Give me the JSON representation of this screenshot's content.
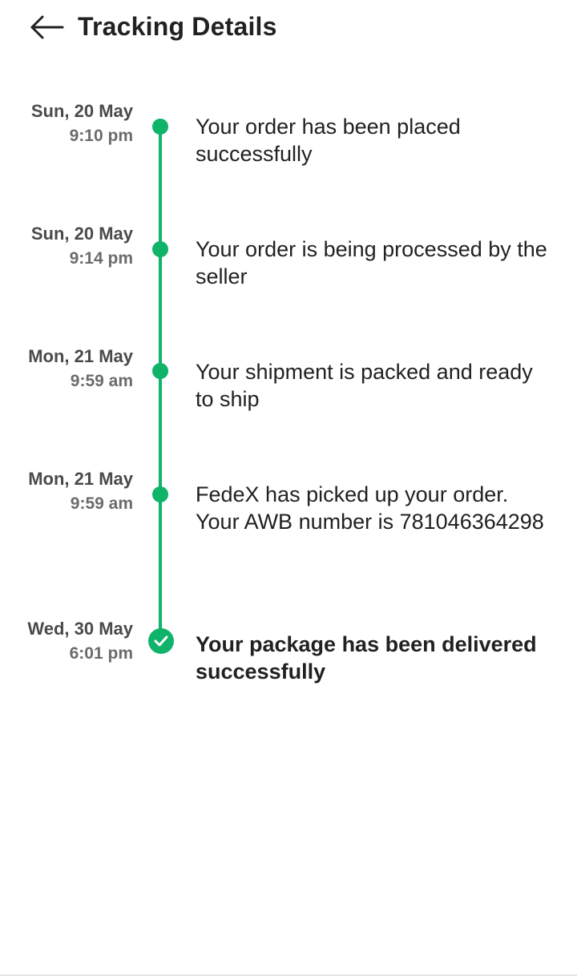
{
  "header": {
    "title": "Tracking Details",
    "back_icon": "arrow-left-icon"
  },
  "colors": {
    "accent": "#0fb36a",
    "text_primary": "#212121",
    "text_date": "#4a4a4a",
    "text_time": "#6b6b6b"
  },
  "events": [
    {
      "date": "Sun, 20 May",
      "time": "9:10 pm",
      "description": "Your order has been placed successfully",
      "completed": false
    },
    {
      "date": "Sun, 20 May",
      "time": "9:14 pm",
      "description": "Your order is being processed by the seller",
      "completed": false
    },
    {
      "date": "Mon, 21 May",
      "time": "9:59 am",
      "description": "Your shipment is packed and ready to ship",
      "completed": false
    },
    {
      "date": "Mon, 21 May",
      "time": "9:59 am",
      "description": "FedeX has picked up your order. Your AWB number is 781046364298",
      "completed": false
    },
    {
      "date": "Wed, 30 May",
      "time": "6:01 pm",
      "description": "Your package has been delivered successfully",
      "completed": true
    }
  ]
}
